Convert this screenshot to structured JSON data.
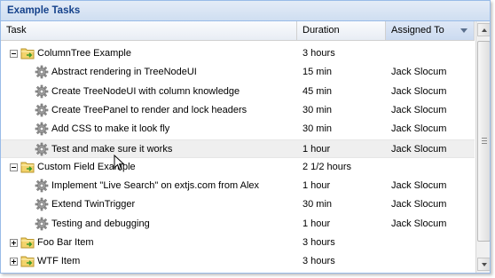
{
  "panel": {
    "title": "Example Tasks"
  },
  "columns": {
    "task": "Task",
    "duration": "Duration",
    "assigned": "Assigned To"
  },
  "rows": [
    {
      "kind": "folder",
      "expanded": true,
      "task": "ColumnTree Example",
      "duration": "3 hours",
      "assigned": ""
    },
    {
      "kind": "leaf",
      "task": "Abstract rendering in TreeNodeUI",
      "duration": "15 min",
      "assigned": "Jack Slocum"
    },
    {
      "kind": "leaf",
      "task": "Create TreeNodeUI with column knowledge",
      "duration": "45 min",
      "assigned": "Jack Slocum"
    },
    {
      "kind": "leaf",
      "task": "Create TreePanel to render and lock headers",
      "duration": "30 min",
      "assigned": "Jack Slocum"
    },
    {
      "kind": "leaf",
      "task": "Add CSS to make it look fly",
      "duration": "30 min",
      "assigned": "Jack Slocum"
    },
    {
      "kind": "leaf",
      "task": "Test and make sure it works",
      "duration": "1 hour",
      "assigned": "Jack Slocum"
    },
    {
      "kind": "folder",
      "expanded": true,
      "task": "Custom Field Example",
      "duration": "2 1/2 hours",
      "assigned": ""
    },
    {
      "kind": "leaf",
      "task": "Implement \"Live Search\" on extjs.com from Alex",
      "duration": "1 hour",
      "assigned": "Jack Slocum"
    },
    {
      "kind": "leaf",
      "task": "Extend TwinTrigger",
      "duration": "30 min",
      "assigned": "Jack Slocum"
    },
    {
      "kind": "leaf",
      "task": "Testing and debugging",
      "duration": "1 hour",
      "assigned": "Jack Slocum"
    },
    {
      "kind": "folder",
      "expanded": false,
      "task": "Foo Bar Item",
      "duration": "3 hours",
      "assigned": ""
    },
    {
      "kind": "folder",
      "expanded": false,
      "task": "WTF Item",
      "duration": "3 hours",
      "assigned": ""
    }
  ],
  "colors": {
    "title_text": "#15428b",
    "border": "#99bbe8",
    "folder_yellow": "#f3d36b",
    "folder_arrow": "#3c9a2a"
  },
  "icons": {
    "folder": "folder-icon",
    "leaf": "gear-icon",
    "expand": "expand-icon",
    "collapse": "collapse-icon"
  }
}
